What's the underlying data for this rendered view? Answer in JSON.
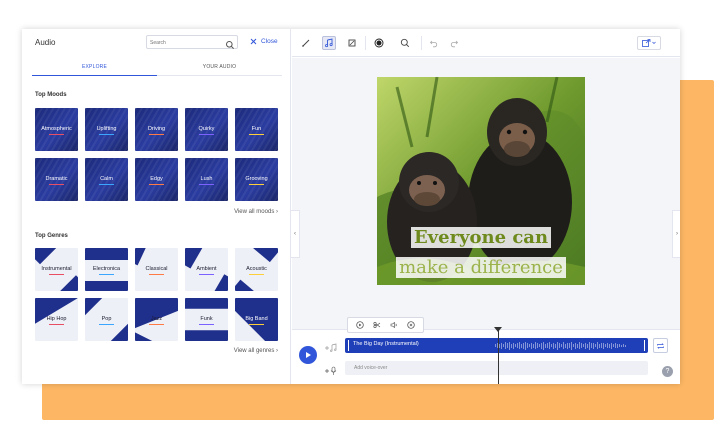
{
  "panel": {
    "title": "Audio",
    "search_placeholder": "Search",
    "close_label": "Close",
    "tabs": [
      "EXPLORE",
      "YOUR AUDIO"
    ]
  },
  "moods": {
    "title": "Top Moods",
    "items": [
      "Atmospheric",
      "Uplifting",
      "Driving",
      "Quirky",
      "Fun",
      "Dramatic",
      "Calm",
      "Edgy",
      "Lush",
      "Grooving"
    ],
    "underline_colors": [
      "#e94f64",
      "#3aa6ff",
      "#ff7a45",
      "#7b61ff",
      "#ffcf3a",
      "#e94f64",
      "#3aa6ff",
      "#ff7a45",
      "#7b61ff",
      "#ffcf3a"
    ],
    "view_all": "View all moods"
  },
  "genres": {
    "title": "Top Genres",
    "items": [
      "Instrumental",
      "Electronica",
      "Classical",
      "Ambient",
      "Acoustic",
      "Hip Hop",
      "Pop",
      "Jazz",
      "Funk",
      "Big Band"
    ],
    "underline_colors": [
      "#e94f64",
      "#3aa6ff",
      "#ff7a45",
      "#7b61ff",
      "#ffcf3a",
      "#e94f64",
      "#3aa6ff",
      "#ff7a45",
      "#7b61ff",
      "#ffcf3a"
    ],
    "view_all": "View all genres"
  },
  "canvas": {
    "line1": "Everyone can",
    "line2": "make a difference"
  },
  "timeline": {
    "track_title": "The Big Day (Instrumental)",
    "voiceover_placeholder": "Add voice-over",
    "help": "?"
  },
  "colors": {
    "accent": "#3156d9",
    "track": "#1f3fb8",
    "backdrop": "#fdb764"
  }
}
